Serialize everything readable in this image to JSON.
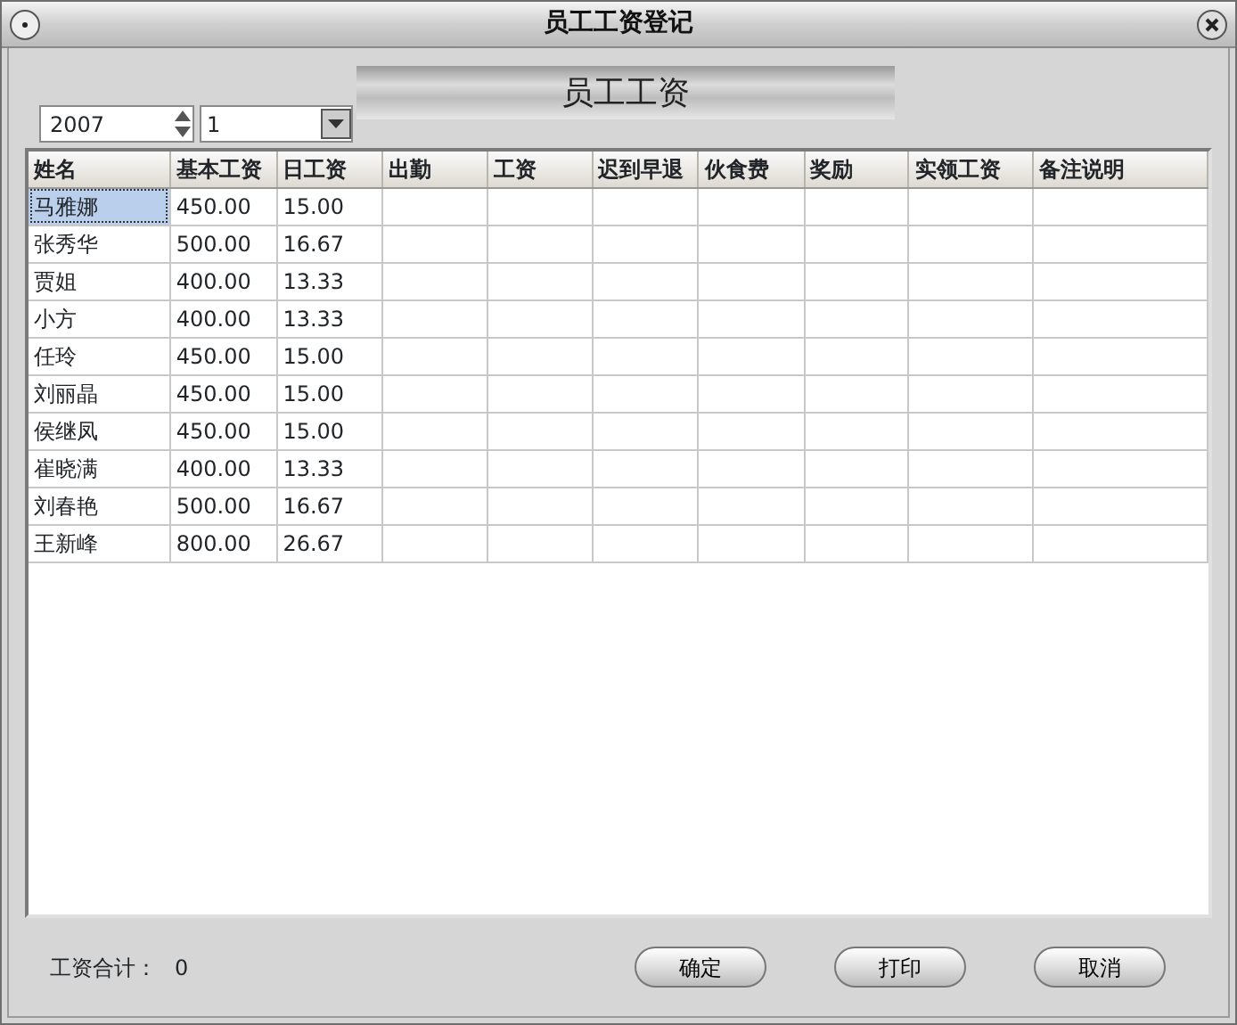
{
  "window": {
    "title": "员工工资登记"
  },
  "banner": "员工工资",
  "year_spinner": {
    "value": "2007"
  },
  "month_select": {
    "value": "1"
  },
  "table": {
    "columns": [
      "姓名",
      "基本工资",
      "日工资",
      "出勤",
      "工资",
      "迟到早退",
      "伙食费",
      "奖励",
      "实领工资",
      "备注说明"
    ],
    "rows": [
      {
        "cells": [
          "马雅娜",
          "450.00",
          "15.00"
        ],
        "selected": true
      },
      {
        "cells": [
          "张秀华",
          "500.00",
          "16.67"
        ],
        "selected": false
      },
      {
        "cells": [
          "贾姐",
          "400.00",
          "13.33"
        ],
        "selected": false
      },
      {
        "cells": [
          "小方",
          "400.00",
          "13.33"
        ],
        "selected": false
      },
      {
        "cells": [
          "任玲",
          "450.00",
          "15.00"
        ],
        "selected": false
      },
      {
        "cells": [
          "刘丽晶",
          "450.00",
          "15.00"
        ],
        "selected": false
      },
      {
        "cells": [
          "侯继凤",
          "450.00",
          "15.00"
        ],
        "selected": false
      },
      {
        "cells": [
          "崔晓满",
          "400.00",
          "13.33"
        ],
        "selected": false
      },
      {
        "cells": [
          "刘春艳",
          "500.00",
          "16.67"
        ],
        "selected": false
      },
      {
        "cells": [
          "王新峰",
          "800.00",
          "26.67"
        ],
        "selected": false
      }
    ]
  },
  "summary": {
    "label": "工资合计：",
    "value": "0"
  },
  "buttons": [
    "确定",
    "打印",
    "取消"
  ]
}
